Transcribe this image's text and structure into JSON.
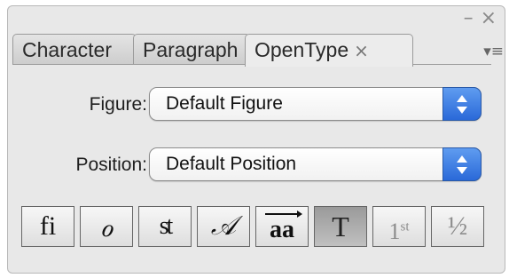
{
  "window": {
    "minimize_glyph": "–",
    "close_glyph": "×"
  },
  "tabs": [
    {
      "label": "Character",
      "active": false
    },
    {
      "label": "Paragraph",
      "active": false
    },
    {
      "label": "OpenType",
      "active": true,
      "close_glyph": "×"
    }
  ],
  "panel_menu_glyph": "▾≡",
  "fields": {
    "figure": {
      "label": "Figure:",
      "value": "Default Figure"
    },
    "position": {
      "label": "Position:",
      "value": "Default Position"
    }
  },
  "features": [
    {
      "name": "standard-ligatures",
      "glyph": "fi",
      "state": "normal"
    },
    {
      "name": "contextual-alternates",
      "glyph": "ℴ",
      "state": "normal"
    },
    {
      "name": "discretionary-ligatures",
      "glyph": "st",
      "state": "normal"
    },
    {
      "name": "swash",
      "glyph": "𝒜",
      "state": "normal"
    },
    {
      "name": "stylistic-alternates",
      "glyph": "aa",
      "state": "normal"
    },
    {
      "name": "titling-alternates",
      "glyph": "T",
      "state": "active"
    },
    {
      "name": "ordinals",
      "glyph": "1st",
      "state": "disabled"
    },
    {
      "name": "fractions",
      "glyph": "½",
      "state": "disabled"
    }
  ],
  "colors": {
    "stepper": "#2a69d8",
    "panel_bg": "#e8e8e8"
  }
}
